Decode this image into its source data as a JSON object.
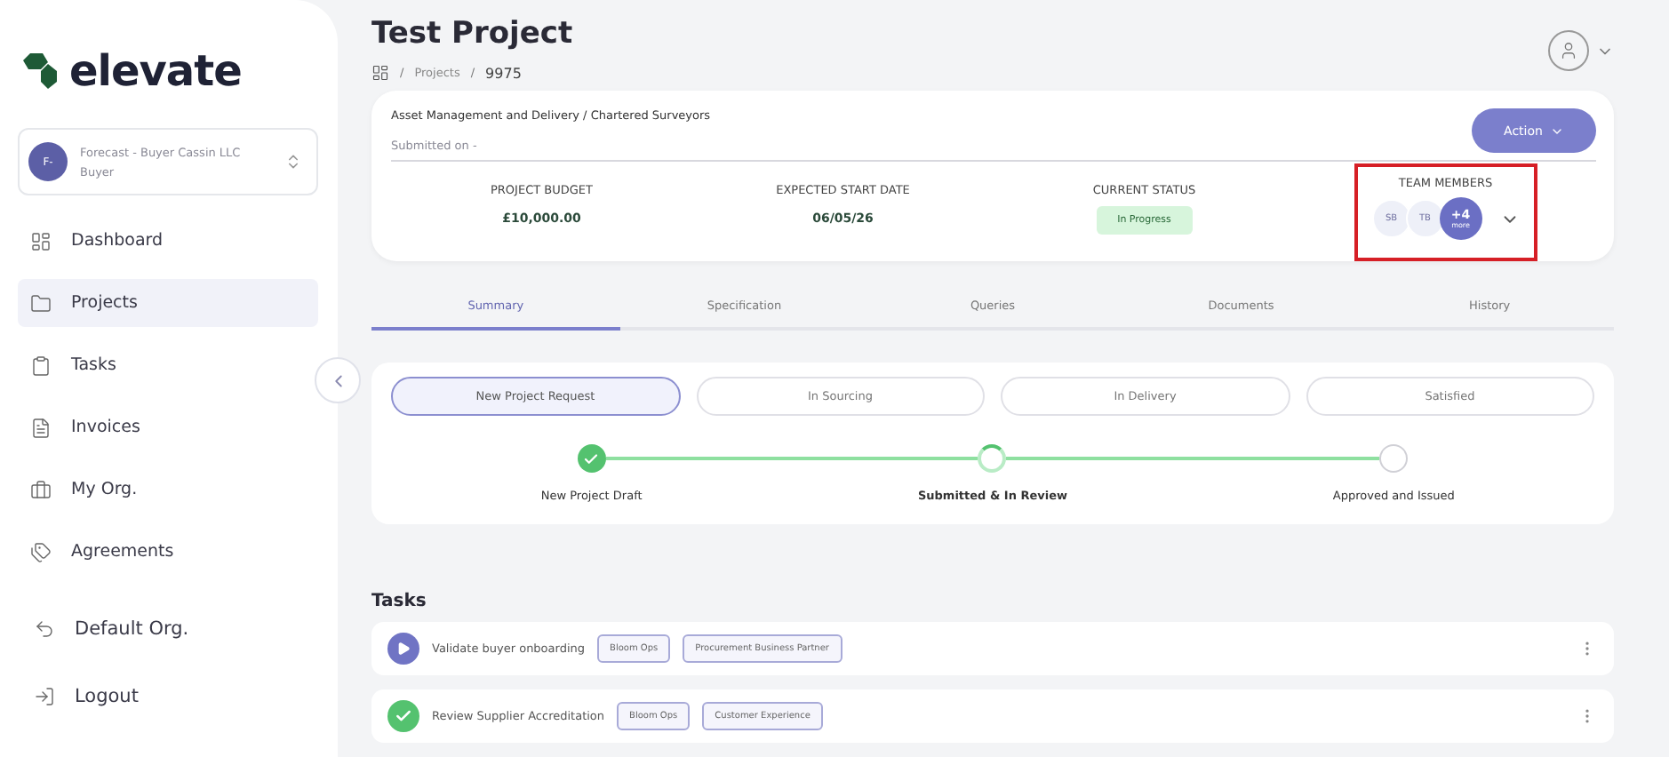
{
  "brand": {
    "name": "elevate"
  },
  "org_switcher": {
    "initials": "F-",
    "name": "Forecast - Buyer Cassin LLC",
    "role": "Buyer"
  },
  "sidebar": {
    "items": [
      {
        "label": "Dashboard",
        "selected": false
      },
      {
        "label": "Projects",
        "selected": true
      },
      {
        "label": "Tasks",
        "selected": false
      },
      {
        "label": "Invoices",
        "selected": false
      },
      {
        "label": "My Org.",
        "selected": false
      },
      {
        "label": "Agreements",
        "selected": false
      }
    ],
    "footer_items": [
      {
        "label": "Default Org."
      },
      {
        "label": "Logout"
      }
    ]
  },
  "page": {
    "title": "Test Project",
    "breadcrumb_separator": "/",
    "breadcrumb": [
      "Projects",
      "9975"
    ]
  },
  "project_card": {
    "category": "Asset Management and Delivery / Chartered Surveyors",
    "submitted": "Submitted on -",
    "action_label": "Action",
    "stats": [
      {
        "label": "PROJECT BUDGET",
        "value": "£10,000.00"
      },
      {
        "label": "EXPECTED START DATE",
        "value": "06/05/26"
      }
    ],
    "status": {
      "label": "CURRENT STATUS",
      "value": "In Progress"
    },
    "team": {
      "label": "TEAM MEMBERS",
      "highlighted": true,
      "members": [
        "SB",
        "TB"
      ],
      "more_count": "+4",
      "more_label": "more"
    }
  },
  "tabs": [
    {
      "label": "Summary",
      "selected": true
    },
    {
      "label": "Specification",
      "selected": false
    },
    {
      "label": "Queries",
      "selected": false
    },
    {
      "label": "Documents",
      "selected": false
    },
    {
      "label": "History",
      "selected": false
    }
  ],
  "stages": [
    {
      "label": "New Project Request",
      "selected": true
    },
    {
      "label": "In Sourcing",
      "selected": false
    },
    {
      "label": "In Delivery",
      "selected": false
    },
    {
      "label": "Satisfied",
      "selected": false
    }
  ],
  "steps": [
    {
      "label": "New Project Draft",
      "kind": "done"
    },
    {
      "label": "Submitted & In Review",
      "kind": "current"
    },
    {
      "label": "Approved and Issued",
      "kind": "pending"
    }
  ],
  "tasks": {
    "title": "Tasks",
    "items": [
      {
        "label": "Validate buyer onboarding",
        "kind": "open",
        "tags": [
          "Bloom Ops",
          "Procurement Business Partner"
        ]
      },
      {
        "label": "Review Supplier Accreditation",
        "kind": "done",
        "tags": [
          "Bloom Ops",
          "Customer Experience"
        ]
      }
    ]
  }
}
